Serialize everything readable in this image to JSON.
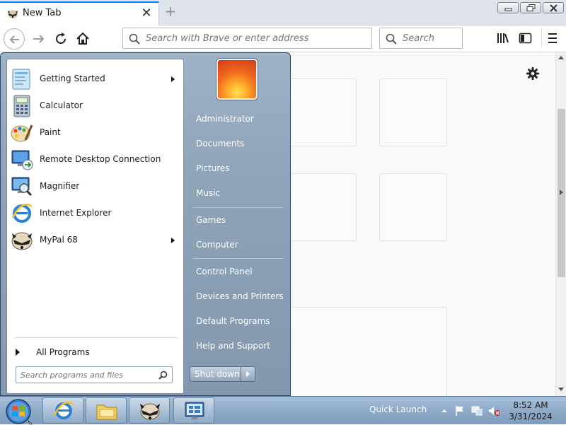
{
  "browser": {
    "tab": {
      "title": "New Tab",
      "icon": "raccoon-icon"
    },
    "urlbar": {
      "placeholder": "Search with Brave or enter address"
    },
    "searchbar": {
      "placeholder": "Search"
    }
  },
  "start_menu": {
    "programs": [
      {
        "label": "Getting Started",
        "icon": "getting-started-icon",
        "has_submenu": true
      },
      {
        "label": "Calculator",
        "icon": "calculator-icon",
        "has_submenu": false
      },
      {
        "label": "Paint",
        "icon": "paint-icon",
        "has_submenu": false
      },
      {
        "label": "Remote Desktop Connection",
        "icon": "remote-desktop-icon",
        "has_submenu": false
      },
      {
        "label": "Magnifier",
        "icon": "magnifier-icon",
        "has_submenu": false
      },
      {
        "label": "Internet Explorer",
        "icon": "internet-explorer-icon",
        "has_submenu": false
      },
      {
        "label": "MyPal 68",
        "icon": "mypal-icon",
        "has_submenu": true
      }
    ],
    "all_programs": "All Programs",
    "search_placeholder": "Search programs and files",
    "right_links": [
      "Administrator",
      "Documents",
      "Pictures",
      "Music",
      "Games",
      "Computer",
      "Control Panel",
      "Devices and Printers",
      "Default Programs",
      "Help and Support"
    ],
    "shutdown_label": "Shut down"
  },
  "taskbar": {
    "quick_launch": "Quick Launch",
    "time": "8:52 AM",
    "date": "3/31/2024"
  },
  "colors": {
    "accent": "#0a84ff",
    "start_menu_bg": "#8ea2b8",
    "taskbar_bg": "#8eaac8"
  }
}
